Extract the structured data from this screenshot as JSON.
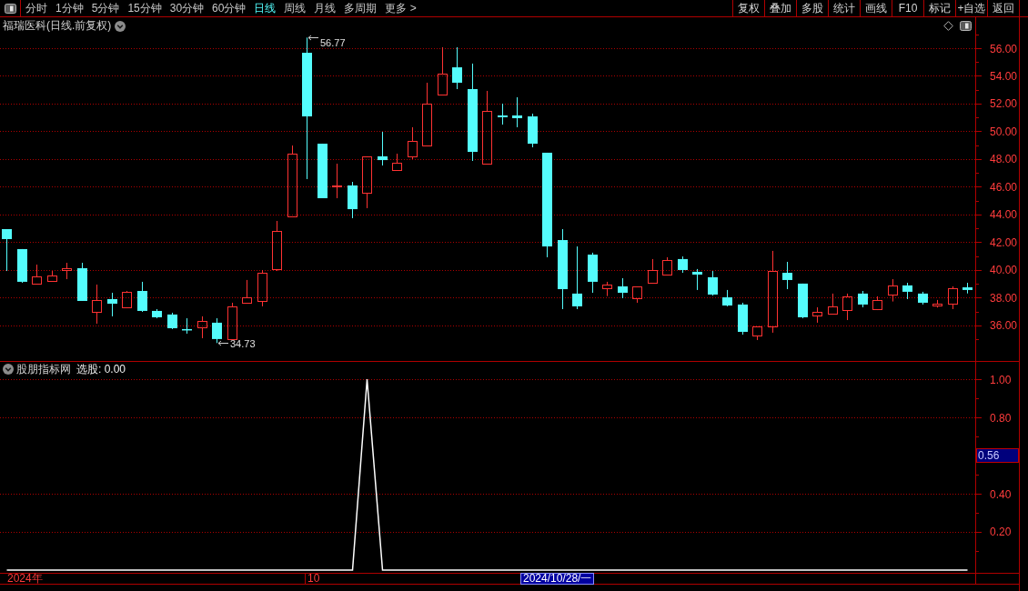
{
  "toolbar": {
    "periods": [
      {
        "label": "分时",
        "selected": false
      },
      {
        "label": "1分钟",
        "selected": false
      },
      {
        "label": "5分钟",
        "selected": false
      },
      {
        "label": "15分钟",
        "selected": false
      },
      {
        "label": "30分钟",
        "selected": false
      },
      {
        "label": "60分钟",
        "selected": false
      },
      {
        "label": "日线",
        "selected": true
      },
      {
        "label": "周线",
        "selected": false
      },
      {
        "label": "月线",
        "selected": false
      },
      {
        "label": "多周期",
        "selected": false
      }
    ],
    "more": "更多 >",
    "actions": [
      "复权",
      "叠加",
      "多股",
      "统计",
      "画线",
      "F10",
      "标记",
      "+自选",
      "返回"
    ]
  },
  "main_chart": {
    "title": "福瑞医科(日线.前复权)",
    "chart_data": {
      "type": "candlestick",
      "grid": true,
      "ylim": [
        33.44,
        58.23
      ],
      "yticks": [
        {
          "value": 56,
          "label": "56.00"
        },
        {
          "value": 54,
          "label": "54.00"
        },
        {
          "value": 52,
          "label": "52.00"
        },
        {
          "value": 50,
          "label": "50.00"
        },
        {
          "value": 48,
          "label": "48.00"
        },
        {
          "value": 46,
          "label": "46.00"
        },
        {
          "value": 44,
          "label": "44.00"
        },
        {
          "value": 42,
          "label": "42.00"
        },
        {
          "value": 40,
          "label": "40.00"
        },
        {
          "value": 38,
          "label": "38.00"
        },
        {
          "value": 36,
          "label": "36.00"
        }
      ],
      "ohlc": [
        [
          42.95,
          42.95,
          39.93,
          42.23
        ],
        [
          41.51,
          41.51,
          39.08,
          39.15
        ],
        [
          39.02,
          40.39,
          39.02,
          39.54
        ],
        [
          39.21,
          39.93,
          39.15,
          39.61
        ],
        [
          40.0,
          40.52,
          39.34,
          40.13
        ],
        [
          40.13,
          40.52,
          37.77,
          37.77
        ],
        [
          36.98,
          38.95,
          36.13,
          37.84
        ],
        [
          37.9,
          38.36,
          36.66,
          37.57
        ],
        [
          37.31,
          38.49,
          37.31,
          38.43
        ],
        [
          38.49,
          39.15,
          36.98,
          37.05
        ],
        [
          37.05,
          37.18,
          36.52,
          36.59
        ],
        [
          36.79,
          36.92,
          35.74,
          35.8
        ],
        [
          35.74,
          36.52,
          35.41,
          35.64
        ],
        [
          35.87,
          36.66,
          35.08,
          36.33
        ],
        [
          36.2,
          36.52,
          34.73,
          35.02
        ],
        [
          35.02,
          37.64,
          35.02,
          37.38
        ],
        [
          37.64,
          39.28,
          37.64,
          38.03
        ],
        [
          37.77,
          40.0,
          37.38,
          39.8
        ],
        [
          40.07,
          43.54,
          39.93,
          42.82
        ],
        [
          43.87,
          48.98,
          43.87,
          48.39
        ],
        [
          55.67,
          56.77,
          46.56,
          51.08
        ],
        [
          49.11,
          49.11,
          45.18,
          45.18
        ],
        [
          46.05,
          47.67,
          45.18,
          46.1
        ],
        [
          46.1,
          46.36,
          43.74,
          44.39
        ],
        [
          45.57,
          48.2,
          44.46,
          48.2
        ],
        [
          48.2,
          49.97,
          47.54,
          47.93
        ],
        [
          47.21,
          48.39,
          47.21,
          47.74
        ],
        [
          48.2,
          50.3,
          48.0,
          49.31
        ],
        [
          48.98,
          53.51,
          48.98,
          52.0
        ],
        [
          52.66,
          56.07,
          52.59,
          54.16
        ],
        [
          54.62,
          56.07,
          53.05,
          53.51
        ],
        [
          53.05,
          54.89,
          47.87,
          48.52
        ],
        [
          47.67,
          52.92,
          47.67,
          51.48
        ],
        [
          51.15,
          52.0,
          50.49,
          51.02
        ],
        [
          51.15,
          52.46,
          50.3,
          50.95
        ],
        [
          51.08,
          51.28,
          48.85,
          49.11
        ],
        [
          48.46,
          48.46,
          40.92,
          41.7
        ],
        [
          42.16,
          42.95,
          37.18,
          38.62
        ],
        [
          38.3,
          41.7,
          37.18,
          37.38
        ],
        [
          41.11,
          41.25,
          38.36,
          39.15
        ],
        [
          38.69,
          39.15,
          38.12,
          38.95
        ],
        [
          38.82,
          39.41,
          37.97,
          38.36
        ],
        [
          37.97,
          38.8,
          37.64,
          38.8
        ],
        [
          39.08,
          40.79,
          39.08,
          40.0
        ],
        [
          39.67,
          40.92,
          39.61,
          40.72
        ],
        [
          40.79,
          40.98,
          39.8,
          40.0
        ],
        [
          39.87,
          40.07,
          38.56,
          39.67
        ],
        [
          39.48,
          39.93,
          38.16,
          38.23
        ],
        [
          38.03,
          38.56,
          37.38,
          37.44
        ],
        [
          37.51,
          37.64,
          35.34,
          35.54
        ],
        [
          35.3,
          35.93,
          34.95,
          35.93
        ],
        [
          35.93,
          41.38,
          35.48,
          39.93
        ],
        [
          39.8,
          40.59,
          38.62,
          39.28
        ],
        [
          39.02,
          39.02,
          36.52,
          36.59
        ],
        [
          36.72,
          37.31,
          36.2,
          36.98
        ],
        [
          36.85,
          38.3,
          36.85,
          37.38
        ],
        [
          37.11,
          38.3,
          36.39,
          38.1
        ],
        [
          38.3,
          38.49,
          37.31,
          37.51
        ],
        [
          37.18,
          38.1,
          37.11,
          37.84
        ],
        [
          38.23,
          39.34,
          37.73,
          38.89
        ],
        [
          38.89,
          39.08,
          37.9,
          38.43
        ],
        [
          38.3,
          38.43,
          37.51,
          37.64
        ],
        [
          37.46,
          37.84,
          37.29,
          37.55
        ],
        [
          37.57,
          38.82,
          37.18,
          38.69
        ],
        [
          38.75,
          39.08,
          38.31,
          38.56
        ]
      ],
      "annotations": [
        "56.77",
        "34.73"
      ]
    }
  },
  "indicator": {
    "name": "股朋指标网",
    "output": "选股: 0.00",
    "cursor_value": "0.56",
    "chart_data": {
      "type": "line",
      "grid": true,
      "ylim": [
        -0.0143,
        1.0905
      ],
      "yticks": [
        {
          "value": 1.0,
          "label": "1.00"
        },
        {
          "value": 0.8,
          "label": "0.80"
        },
        {
          "value": 0.4,
          "label": "0.40"
        },
        {
          "value": 0.2,
          "label": "0.20"
        }
      ],
      "series": [
        {
          "color": "#ffffff",
          "values": [
            0,
            0,
            0,
            0,
            0,
            0,
            0,
            0,
            0,
            0,
            0,
            0,
            0,
            0,
            0,
            0,
            0,
            0,
            0,
            0,
            0,
            0,
            0,
            0,
            1,
            0,
            0,
            0,
            0,
            0,
            0,
            0,
            0,
            0,
            0,
            0,
            0,
            0,
            0,
            0,
            0,
            0,
            0,
            0,
            0,
            0,
            0,
            0,
            0,
            0,
            0,
            0,
            0,
            0,
            0,
            0,
            0,
            0,
            0,
            0,
            0,
            0,
            0,
            0,
            0
          ]
        }
      ]
    }
  },
  "time_axis": {
    "labels": [
      "2024年",
      "10"
    ],
    "cursor_date": "2024/10/28/一"
  }
}
